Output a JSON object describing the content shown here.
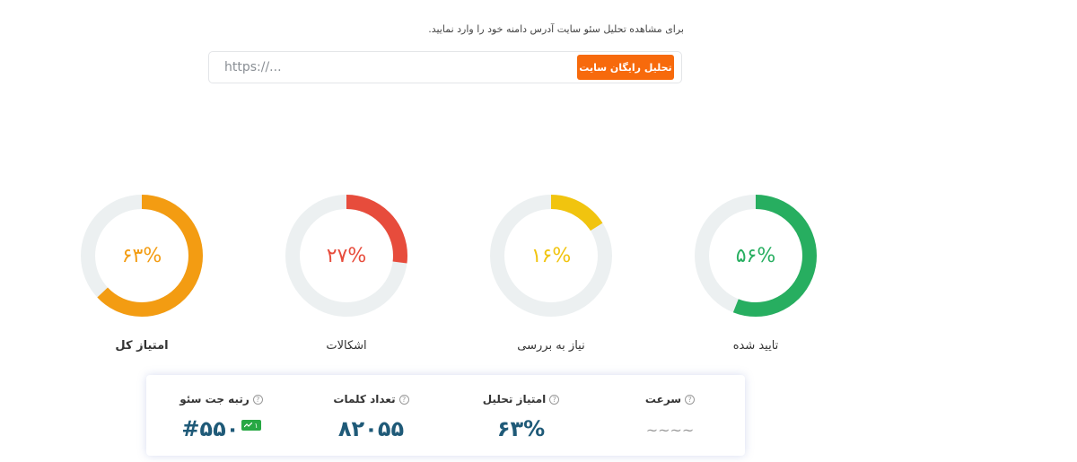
{
  "analyzer": {
    "instruction": "برای مشاهده تحلیل سئو سایت آدرس دامنه خود را وارد نمایید.",
    "input_placeholder": "https://...",
    "button_label": "تحلیل رایگان سایت"
  },
  "gauges": [
    {
      "key": "overall",
      "value_text": "۶۳%",
      "fraction": 0.63,
      "label": "امتیاز کل",
      "color": "#f39c12",
      "track": "#ecf0f1"
    },
    {
      "key": "issues",
      "value_text": "۲۷%",
      "fraction": 0.27,
      "label": "اشکالات",
      "color": "#e74c3c",
      "track": "#ecf0f1"
    },
    {
      "key": "review",
      "value_text": "۱۶%",
      "fraction": 0.16,
      "label": "نیاز به بررسی",
      "color": "#f1c40f",
      "track": "#ecf0f1"
    },
    {
      "key": "approved",
      "value_text": "۵۶%",
      "fraction": 0.56,
      "label": "تایید شده",
      "color": "#27ae60",
      "track": "#ecf0f1"
    }
  ],
  "stats": {
    "help_glyph": "?",
    "rank": {
      "title": "رتبه جت سئو",
      "value": "#۵۵۰",
      "badge_text": "۱",
      "badge_color": "#27a844"
    },
    "words": {
      "title": "تعداد کلمات",
      "value": "۸۲۰۵۵"
    },
    "score": {
      "title": "امتیاز تحلیل",
      "value": "۶۳%"
    },
    "speed": {
      "title": "سرعت",
      "value": "~~~~"
    }
  }
}
